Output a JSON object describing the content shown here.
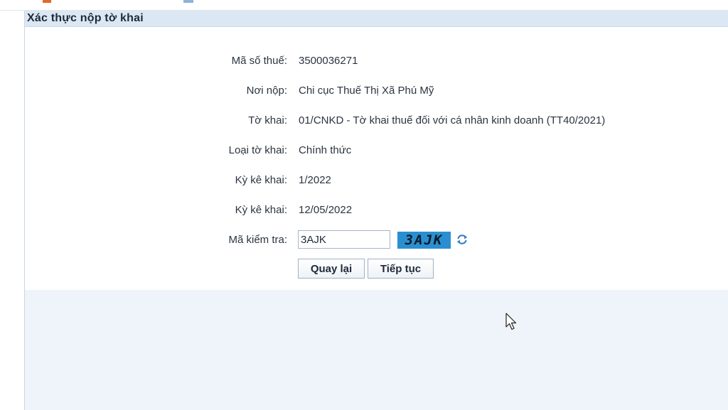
{
  "panel": {
    "title": "Xác thực nộp tờ khai"
  },
  "form": {
    "tax_code_label": "Mã số thuế:",
    "tax_code_value": "3500036271",
    "submit_to_label": "Nơi nộp:",
    "submit_to_value": "Chi cục Thuế Thị Xã Phú Mỹ",
    "declaration_label": "Tờ khai:",
    "declaration_value": "01/CNKD - Tờ khai thuế đối với cá nhân kinh doanh (TT40/2021)",
    "declaration_type_label": "Loại tờ khai:",
    "declaration_type_value": "Chính thức",
    "period_label": "Kỳ kê khai:",
    "period_value": "1/2022",
    "date_label": "Kỳ kê khai:",
    "date_value": "12/05/2022",
    "captcha_label": "Mã kiểm tra:",
    "captcha_input_value": "3AJK",
    "captcha_image_text": "3AJK"
  },
  "buttons": {
    "back_label": "Quay lại",
    "continue_label": "Tiếp tục"
  },
  "icons": {
    "refresh": "refresh-icon",
    "cursor": "mouse-cursor-icon"
  },
  "colors": {
    "captcha_bg": "#2a8fd0",
    "header_bg": "#dbe8f4",
    "lower_bg": "#eef4fa"
  }
}
